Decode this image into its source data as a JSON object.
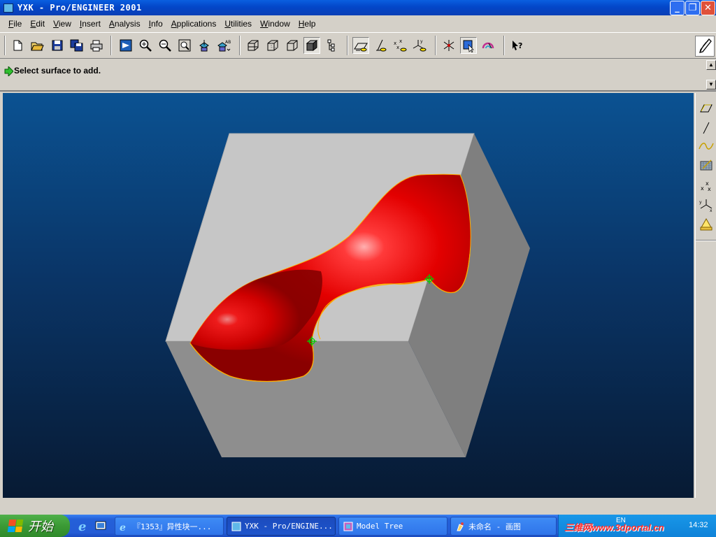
{
  "window": {
    "title": "YXK - Pro/ENGINEER 2001",
    "controls": [
      "minimize",
      "restore",
      "close"
    ]
  },
  "menu": [
    "File",
    "Edit",
    "View",
    "Insert",
    "Analysis",
    "Info",
    "Applications",
    "Utilities",
    "Window",
    "Help"
  ],
  "toolbar": {
    "groups": [
      [
        "new-icon",
        "open-icon",
        "save-icon",
        "save-copy-icon",
        "print-icon"
      ],
      [
        "repaint-icon",
        "zoom-in-icon",
        "zoom-out-icon",
        "refit-icon",
        "orient-icon",
        "saved-views-icon"
      ],
      [
        "wireframe-icon",
        "hidden-line-icon",
        "no-hidden-icon",
        "shading-icon",
        "model-tree-icon"
      ],
      [
        "datum-planes-icon",
        "datum-axes-icon",
        "datum-points-icon",
        "coordinate-systems-icon"
      ],
      [
        "spin-center-icon",
        "selection-filter-icon",
        "regenerate-icon"
      ],
      [
        "context-help-icon"
      ]
    ],
    "pressed": [
      "shading-icon",
      "datum-planes-icon",
      "selection-filter-icon"
    ]
  },
  "message": {
    "text": "Select surface to add."
  },
  "right_toolbar": [
    "datum-plane-tool-icon",
    "datum-axis-tool-icon",
    "datum-curve-tool-icon",
    "sketch-datum-icon",
    "datum-point-tool-icon",
    "datum-csys-tool-icon",
    "analysis-tool-icon"
  ],
  "model": {
    "block_colors": {
      "top": "#c8c8c8",
      "left": "#a8a8a8",
      "front": "#8e8e8e",
      "right": "#7f7f7f"
    },
    "surface_color": "#e00000",
    "edge_highlight": "#ffb000",
    "selection_marker_color": "#00d000"
  },
  "taskbar": {
    "start_label": "开始",
    "tasks": [
      {
        "icon": "ie-icon",
        "label": "『1353』异性块一..."
      },
      {
        "icon": "proe-icon",
        "label": "YXK - Pro/ENGINE..."
      },
      {
        "icon": "proe-icon",
        "label": "Model Tree"
      },
      {
        "icon": "paint-icon",
        "label": "未命名 - 画图"
      }
    ],
    "active_task": 1,
    "tray": {
      "watermark": "三维网www.3dportal.cn",
      "lang": "EN",
      "clock": "14:32"
    }
  }
}
